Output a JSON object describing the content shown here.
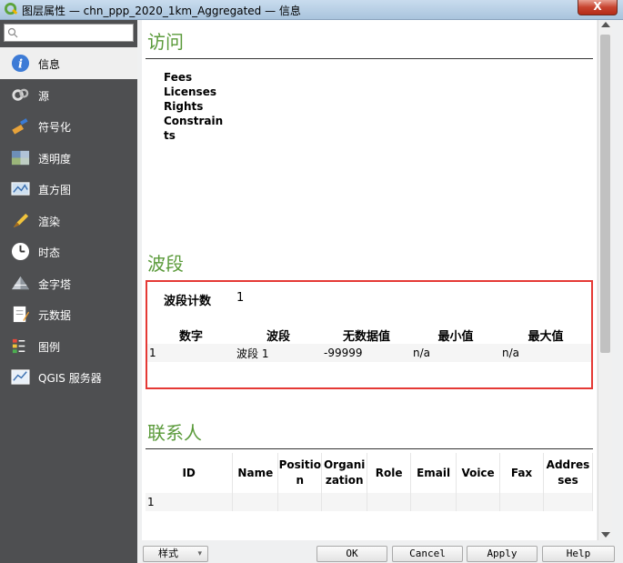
{
  "window": {
    "title": "图层属性 — chn_ppp_2020_1km_Aggregated — 信息",
    "close_label": "X"
  },
  "sidebar": {
    "search_placeholder": "",
    "items": [
      {
        "label": "信息",
        "icon": "info-icon"
      },
      {
        "label": "源",
        "icon": "source-icon"
      },
      {
        "label": "符号化",
        "icon": "symbology-icon"
      },
      {
        "label": "透明度",
        "icon": "transparency-icon"
      },
      {
        "label": "直方图",
        "icon": "histogram-icon"
      },
      {
        "label": "渲染",
        "icon": "render-icon"
      },
      {
        "label": "时态",
        "icon": "clock-icon"
      },
      {
        "label": "金字塔",
        "icon": "pyramid-icon"
      },
      {
        "label": "元数据",
        "icon": "metadata-icon"
      },
      {
        "label": "图例",
        "icon": "legend-icon"
      },
      {
        "label": "QGIS 服务器",
        "icon": "server-icon"
      }
    ]
  },
  "access": {
    "title": "访问",
    "items": [
      "Fees",
      "Licenses",
      "Rights",
      "Constraints"
    ]
  },
  "bands": {
    "title": "波段",
    "count_label": "波段计数",
    "count_value": "1",
    "columns": [
      "数字",
      "波段",
      "无数据值",
      "最小值",
      "最大值"
    ],
    "rows": [
      [
        "1",
        "波段 1",
        "-99999",
        "n/a",
        "n/a"
      ]
    ]
  },
  "contacts": {
    "title": "联系人",
    "columns": [
      "ID",
      "Name",
      "Position",
      "Organization",
      "Role",
      "Email",
      "Voice",
      "Fax",
      "Addresses"
    ],
    "rows": [
      [
        "1",
        "",
        "",
        "",
        "",
        "",
        "",
        "",
        ""
      ]
    ]
  },
  "buttons": {
    "style": "样式",
    "ok": "OK",
    "cancel": "Cancel",
    "apply": "Apply",
    "help": "Help"
  },
  "colors": {
    "section_title": "#5a9a3a",
    "highlight_border": "#e53935",
    "sidebar_bg": "#4e4f51"
  }
}
